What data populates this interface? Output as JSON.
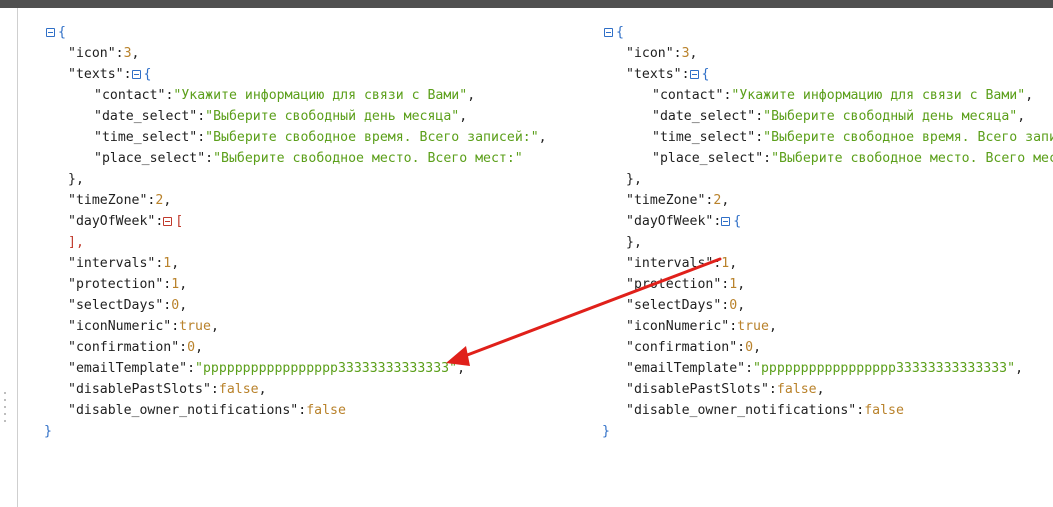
{
  "left": {
    "icon_key": "\"icon\"",
    "icon_val": "3",
    "texts_key": "\"texts\"",
    "contact_key": "\"contact\"",
    "contact_val": "\"Укажите информацию для связи с Вами\"",
    "date_key": "\"date_select\"",
    "date_val": "\"Выберите свободный день месяца\"",
    "time_key": "\"time_select\"",
    "time_val": "\"Выберите свободное время. Всего записей:\"",
    "place_key": "\"place_select\"",
    "place_val": "\"Выберите свободное место. Всего мест:\"",
    "tz_key": "\"timeZone\"",
    "tz_val": "2",
    "dow_key": "\"dayOfWeek\"",
    "dow_open": "[",
    "dow_close": "],",
    "intervals_key": "\"intervals\"",
    "intervals_val": "1",
    "protection_key": "\"protection\"",
    "protection_val": "1",
    "selectdays_key": "\"selectDays\"",
    "selectdays_val": "0",
    "iconnum_key": "\"iconNumeric\"",
    "iconnum_val": "true",
    "confirm_key": "\"confirmation\"",
    "confirm_val": "0",
    "email_key": "\"emailTemplate\"",
    "email_val": "\"ppppppppppppppppp33333333333333\"",
    "disablepast_key": "\"disablePastSlots\"",
    "disablepast_val": "false",
    "disableowner_key": "\"disable_owner_notifications\"",
    "disableowner_val": "false"
  },
  "right": {
    "icon_key": "\"icon\"",
    "icon_val": "3",
    "texts_key": "\"texts\"",
    "contact_key": "\"contact\"",
    "contact_val": "\"Укажите информацию для связи с Вами\"",
    "date_key": "\"date_select\"",
    "date_val": "\"Выберите свободный день месяца\"",
    "time_key": "\"time_select\"",
    "time_val": "\"Выберите свободное время. Всего записей:\"",
    "place_key": "\"place_select\"",
    "place_val": "\"Выберите свободное место. Всего мест:\"",
    "tz_key": "\"timeZone\"",
    "tz_val": "2",
    "dow_key": "\"dayOfWeek\"",
    "dow_open": "{",
    "dow_close": "},",
    "intervals_key": "\"intervals\"",
    "intervals_val": "1",
    "protection_key": "\"protection\"",
    "protection_val": "1",
    "selectdays_key": "\"selectDays\"",
    "selectdays_val": "0",
    "iconnum_key": "\"iconNumeric\"",
    "iconnum_val": "true",
    "confirm_key": "\"confirmation\"",
    "confirm_val": "0",
    "email_key": "\"emailTemplate\"",
    "email_val": "\"ppppppppppppppppp33333333333333\"",
    "disablepast_key": "\"disablePastSlots\"",
    "disablepast_val": "false",
    "disableowner_key": "\"disable_owner_notifications\"",
    "disableowner_val": "false"
  },
  "syntax": {
    "colon": ":",
    "comma": ",",
    "open_brace": "{",
    "close_brace": "}",
    "close_brace_comma": "},"
  },
  "annotation": {
    "arrow_color": "#e0201a",
    "icon": "arrow-icon"
  }
}
